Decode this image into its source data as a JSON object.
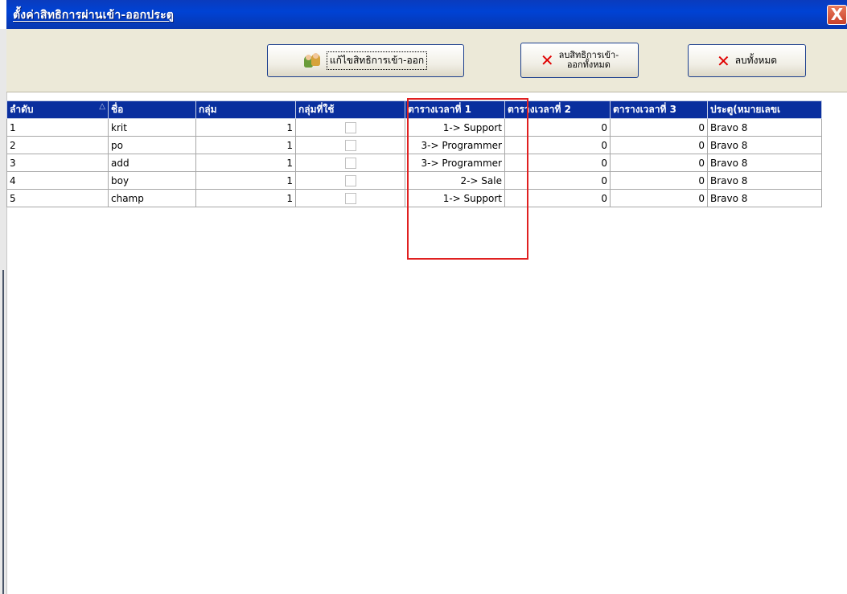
{
  "window": {
    "title": "ตั้งค่าสิทธิการผ่านเข้า-ออกประตู",
    "close_label": "X"
  },
  "toolbar": {
    "edit_label": "แก้ไขสิทธิการเข้า-ออก",
    "delete_rights_label_line1": "ลบสิทธิการเข้า-",
    "delete_rights_label_line2": "ออกทั้งหมด",
    "delete_all_label": "ลบทั้งหมด"
  },
  "icons": {
    "edit": "users-icon",
    "delete": "red-x-icon",
    "sort": "sort-ascending-triangle-icon"
  },
  "colors": {
    "titlebar": "#0042d4",
    "header": "#0a2f9e",
    "highlight": "#e02020",
    "delete_icon": "#e00000"
  },
  "table": {
    "headers": [
      "ลำดับ",
      "ชื่อ",
      "กลุ่ม",
      "กลุ่มที่ใช้",
      "ตารางเวลาที่ 1",
      "ตารางเวลาที่ 2",
      "ตารางเวลาที่ 3",
      "ประตู(หมายเลขเ"
    ],
    "rows": [
      {
        "seq": "1",
        "name": "krit",
        "group": "1",
        "group_used": false,
        "schedule1": "1-> Support",
        "schedule2": "0",
        "schedule3": "0",
        "door": "Bravo 8"
      },
      {
        "seq": "2",
        "name": "po",
        "group": "1",
        "group_used": false,
        "schedule1": "3-> Programmer",
        "schedule2": "0",
        "schedule3": "0",
        "door": "Bravo 8"
      },
      {
        "seq": "3",
        "name": "add",
        "group": "1",
        "group_used": false,
        "schedule1": "3-> Programmer",
        "schedule2": "0",
        "schedule3": "0",
        "door": "Bravo 8"
      },
      {
        "seq": "4",
        "name": "boy",
        "group": "1",
        "group_used": false,
        "schedule1": "2-> Sale",
        "schedule2": "0",
        "schedule3": "0",
        "door": "Bravo 8"
      },
      {
        "seq": "5",
        "name": "champ",
        "group": "1",
        "group_used": false,
        "schedule1": "1-> Support",
        "schedule2": "0",
        "schedule3": "0",
        "door": "Bravo 8"
      }
    ]
  }
}
